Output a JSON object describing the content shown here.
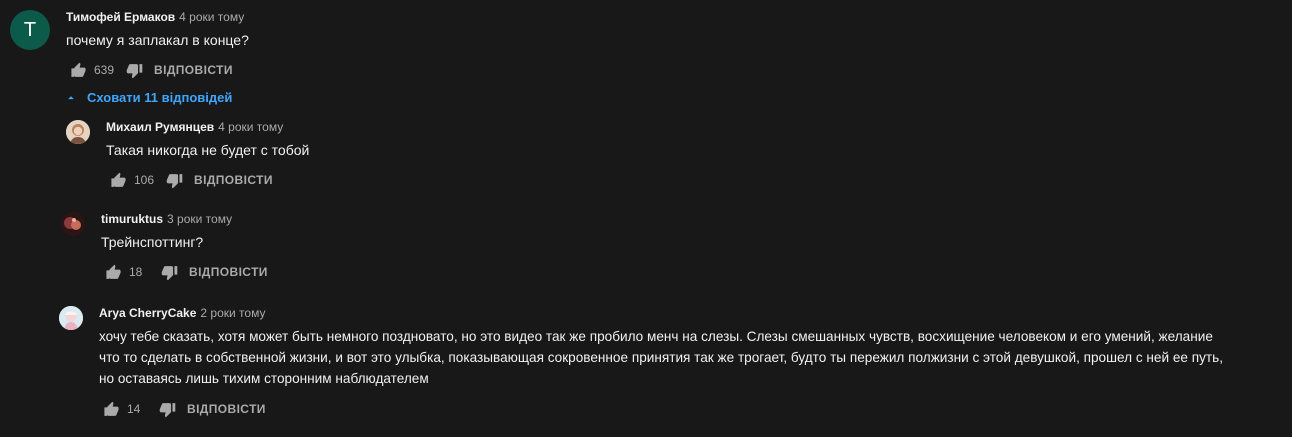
{
  "top_comment": {
    "avatar_letter": "T",
    "author": "Тимофей Ермаков",
    "time": "4 роки тому",
    "text": "почему я заплакал в конце?",
    "likes": "639",
    "reply_label": "ВІДПОВІСТИ"
  },
  "replies_toggle": {
    "label": "Сховати 11 відповідей"
  },
  "replies": [
    {
      "author": "Михаил Румянцев",
      "time": "4 роки тому",
      "text": "Такая никогда не будет с тобой",
      "likes": "106",
      "reply_label": "ВІДПОВІСТИ"
    },
    {
      "author": "timuruktus",
      "time": "3 роки тому",
      "text": "Трейнспоттинг?",
      "likes": "18",
      "reply_label": "ВІДПОВІСТИ"
    },
    {
      "author": "Arya CherryCake",
      "time": "2 роки тому",
      "text": "хочу тебе сказать, хотя может быть немного поздновато, но это видео так же пробило менч на слезы. Слезы смешанных чувств, восхищение человеком и его умений, желание\nчто то сделать в собственной жизни, и вот это улыбка, показывающая сокровенное принятия так же трогает, будто ты пережил полжизни с этой девушкой, прошел с ней ее путь,\nно оставаясь лишь тихим сторонним наблюдателем",
      "likes": "14",
      "reply_label": "ВІДПОВІСТИ"
    }
  ],
  "colors": {
    "background": "#181818",
    "link": "#3ea6ff",
    "secondary_text": "#aaaaaa",
    "avatar_bg": "#0b5a4a"
  },
  "icons": [
    "thumb-up-icon",
    "thumb-down-icon",
    "chevron-up-icon"
  ]
}
